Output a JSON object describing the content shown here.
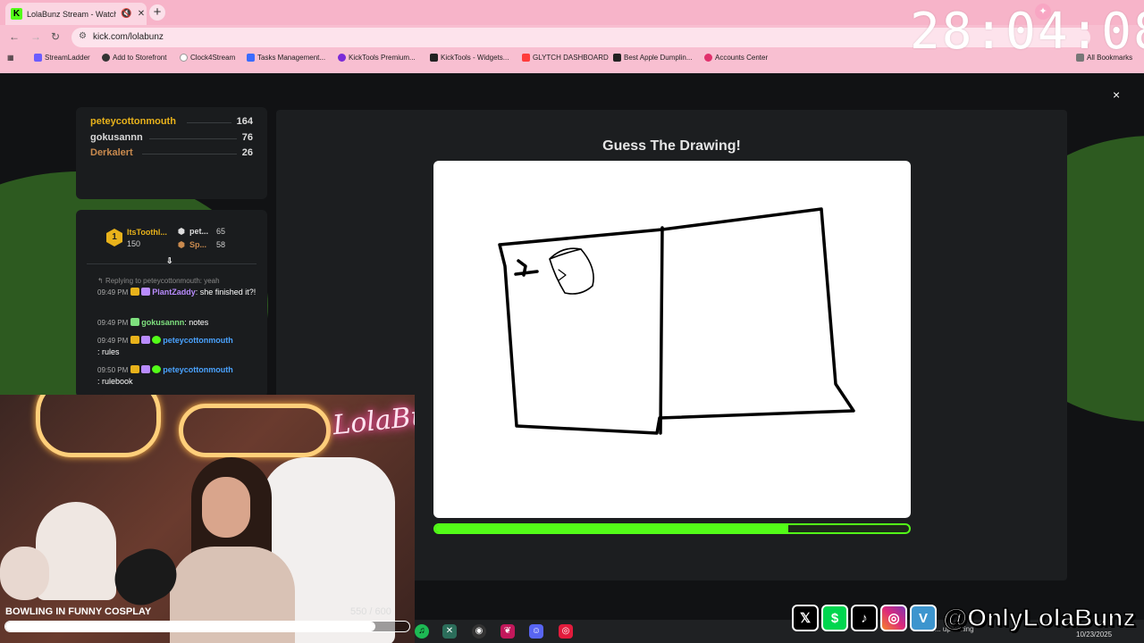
{
  "browser": {
    "tab_title": "LolaBunz Stream - Watch Li",
    "favicon_letter": "K",
    "new_tab_label": "+",
    "url": "kick.com/lolabunz",
    "bookmarks": [
      {
        "label": "StreamLadder",
        "color": "#6b5cff"
      },
      {
        "label": "Add to Storefront",
        "color": "#333333"
      },
      {
        "label": "Clock4Stream",
        "color": "#ffffff"
      },
      {
        "label": "Tasks Management...",
        "color": "#3a6bff"
      },
      {
        "label": "KickTools Premium...",
        "color": "#7a2ad8"
      },
      {
        "label": "KickTools - Widgets...",
        "color": "#222222"
      },
      {
        "label": "GLYTCH DASHBOARD",
        "color": "#ff3c3c"
      },
      {
        "label": "Best Apple Dumplin...",
        "color": "#222222"
      },
      {
        "label": "Accounts Center",
        "color": "#e1306c"
      }
    ],
    "all_bookmarks": "All Bookmarks"
  },
  "overlay": {
    "timer": "28:04:08",
    "subathon_goal": {
      "title": "BOWLING IN FUNNY COSPLAY",
      "count": "550 / 600",
      "progress": 0.917
    },
    "social_handle": "@OnlyLolaBunz",
    "social_icons": [
      "x-icon",
      "cashapp-icon",
      "tiktok-icon",
      "instagram-icon",
      "venmo-icon"
    ]
  },
  "leaderboard": [
    {
      "name": "peteycottonmouth",
      "score": "164",
      "color": "#e8b21b"
    },
    {
      "name": "gokusannn",
      "score": "76",
      "color": "#d8d8d8"
    },
    {
      "name": "Derkalert",
      "score": "26",
      "color": "#c98a4e"
    }
  ],
  "chat": {
    "top_user": {
      "name": "ItsToothl...",
      "points": "150",
      "rank": "1"
    },
    "runners": [
      {
        "name": "pet...",
        "points": "65"
      },
      {
        "name": "Sp...",
        "points": "58"
      }
    ],
    "reply_context": "Replying to peteycottonmouth: yeah",
    "messages": [
      {
        "time": "09:49 PM",
        "user": "PlantZaddy",
        "user_color": "#b98cff",
        "text": ": she finished it?!"
      },
      {
        "time": "09:49 PM",
        "user": "gokusannn",
        "user_color": "#7ee07e",
        "text": ": notes"
      },
      {
        "time": "09:49 PM",
        "user": "peteycottonmouth",
        "user_color": "#4aa3ff",
        "text": ": rules"
      },
      {
        "time": "09:50 PM",
        "user": "peteycottonmouth",
        "user_color": "#4aa3ff",
        "text": ": rulebook"
      }
    ]
  },
  "game": {
    "title": "Guess The Drawing!",
    "round_progress": 0.745,
    "close_label": "×"
  },
  "webcam": {
    "neon_sign": "LolaBunz"
  },
  "taskbar": {
    "upcoming": "... upcoming",
    "clock": "10/23/2025"
  }
}
